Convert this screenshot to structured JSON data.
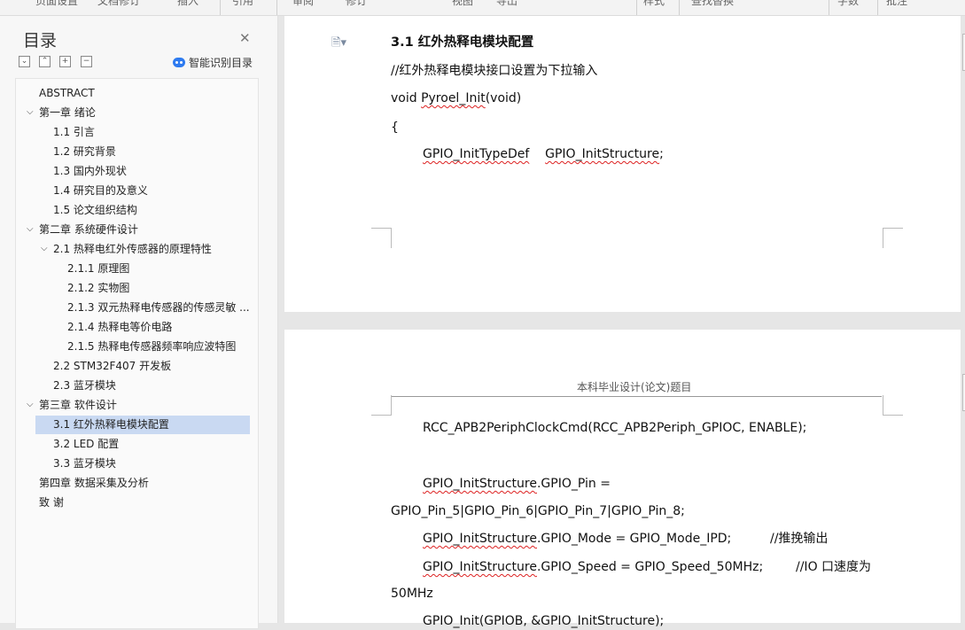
{
  "toolbar": {
    "items": [
      "页面设置",
      "文档修订",
      "插入",
      "引用",
      "审阅",
      "修订",
      "视图",
      "导出",
      "样式",
      "查找替换",
      "字数",
      "批注"
    ]
  },
  "sidebar": {
    "title": "目录",
    "close_icon": "close-icon",
    "tools": [
      "⌄",
      "⌃",
      "+",
      "−"
    ],
    "smart_label": "智能识别目录",
    "items": [
      {
        "label": "ABSTRACT"
      },
      {
        "label": "第一章  绪论"
      },
      {
        "label": "1.1 引言"
      },
      {
        "label": "1.2 研究背景"
      },
      {
        "label": "1.3  国内外现状"
      },
      {
        "label": "1.4  研究目的及意义"
      },
      {
        "label": "1.5 论文组织结构"
      },
      {
        "label": "第二章  系统硬件设计"
      },
      {
        "label": "2.1  热释电红外传感器的原理特性"
      },
      {
        "label": "2.1.1 原理图"
      },
      {
        "label": "2.1.2 实物图"
      },
      {
        "label": "2.1.3 双元热释电传感器的传感灵敏 ..."
      },
      {
        "label": "2.1.4 热释电等价电路"
      },
      {
        "label": "2.1.5 热释电传感器频率响应波特图"
      },
      {
        "label": "2.2 STM32F407 开发板"
      },
      {
        "label": "2.3 蓝牙模块"
      },
      {
        "label": "第三章    软件设计"
      },
      {
        "label": "3.1  红外热释电模块配置"
      },
      {
        "label": "3.2 LED 配置"
      },
      {
        "label": "3.3  蓝牙模块"
      },
      {
        "label": "第四章  数据采集及分析"
      },
      {
        "label": "致    谢"
      }
    ],
    "selected_index": 17
  },
  "document": {
    "page1": {
      "heading": "3.1  红外热释电模块配置",
      "comment": "//红外热释电模块接口设置为下拉输入",
      "l1_a": "void ",
      "l1_b": "Pyroel_Init",
      "l1_c": "(void)",
      "brace": "{",
      "l2_a": "GPIO_InitTypeDef",
      "l2_b": "    ",
      "l2_c": "GPIO_InitStructure",
      "l2_d": ";"
    },
    "page2": {
      "header": "本科毕业设计(论文)题目",
      "l1": "RCC_APB2PeriphClockCmd(RCC_APB2Periph_GPIOC, ENABLE);",
      "l2_a": "GPIO_InitStructure",
      "l2_b": ".GPIO_Pin =",
      "l3": "GPIO_Pin_5|GPIO_Pin_6|GPIO_Pin_7|GPIO_Pin_8;",
      "l4_a": "GPIO_InitStructure",
      "l4_b": ".GPIO_Mode = GPIO_Mode_IPD;",
      "l4_c": "//推挽输出",
      "l5_a": "GPIO_InitStructure",
      "l5_b": ".GPIO_Speed = GPIO_Speed_50MHz;",
      "l5_c": "//IO 口速度为",
      "l6": "50MHz",
      "l7": "GPIO_Init(GPIOB, &GPIO_InitStructure);"
    }
  },
  "colors": {
    "selection": "#c9d9f2",
    "spell_squiggle": "#d22",
    "smart_icon": "#2e7bf0"
  }
}
